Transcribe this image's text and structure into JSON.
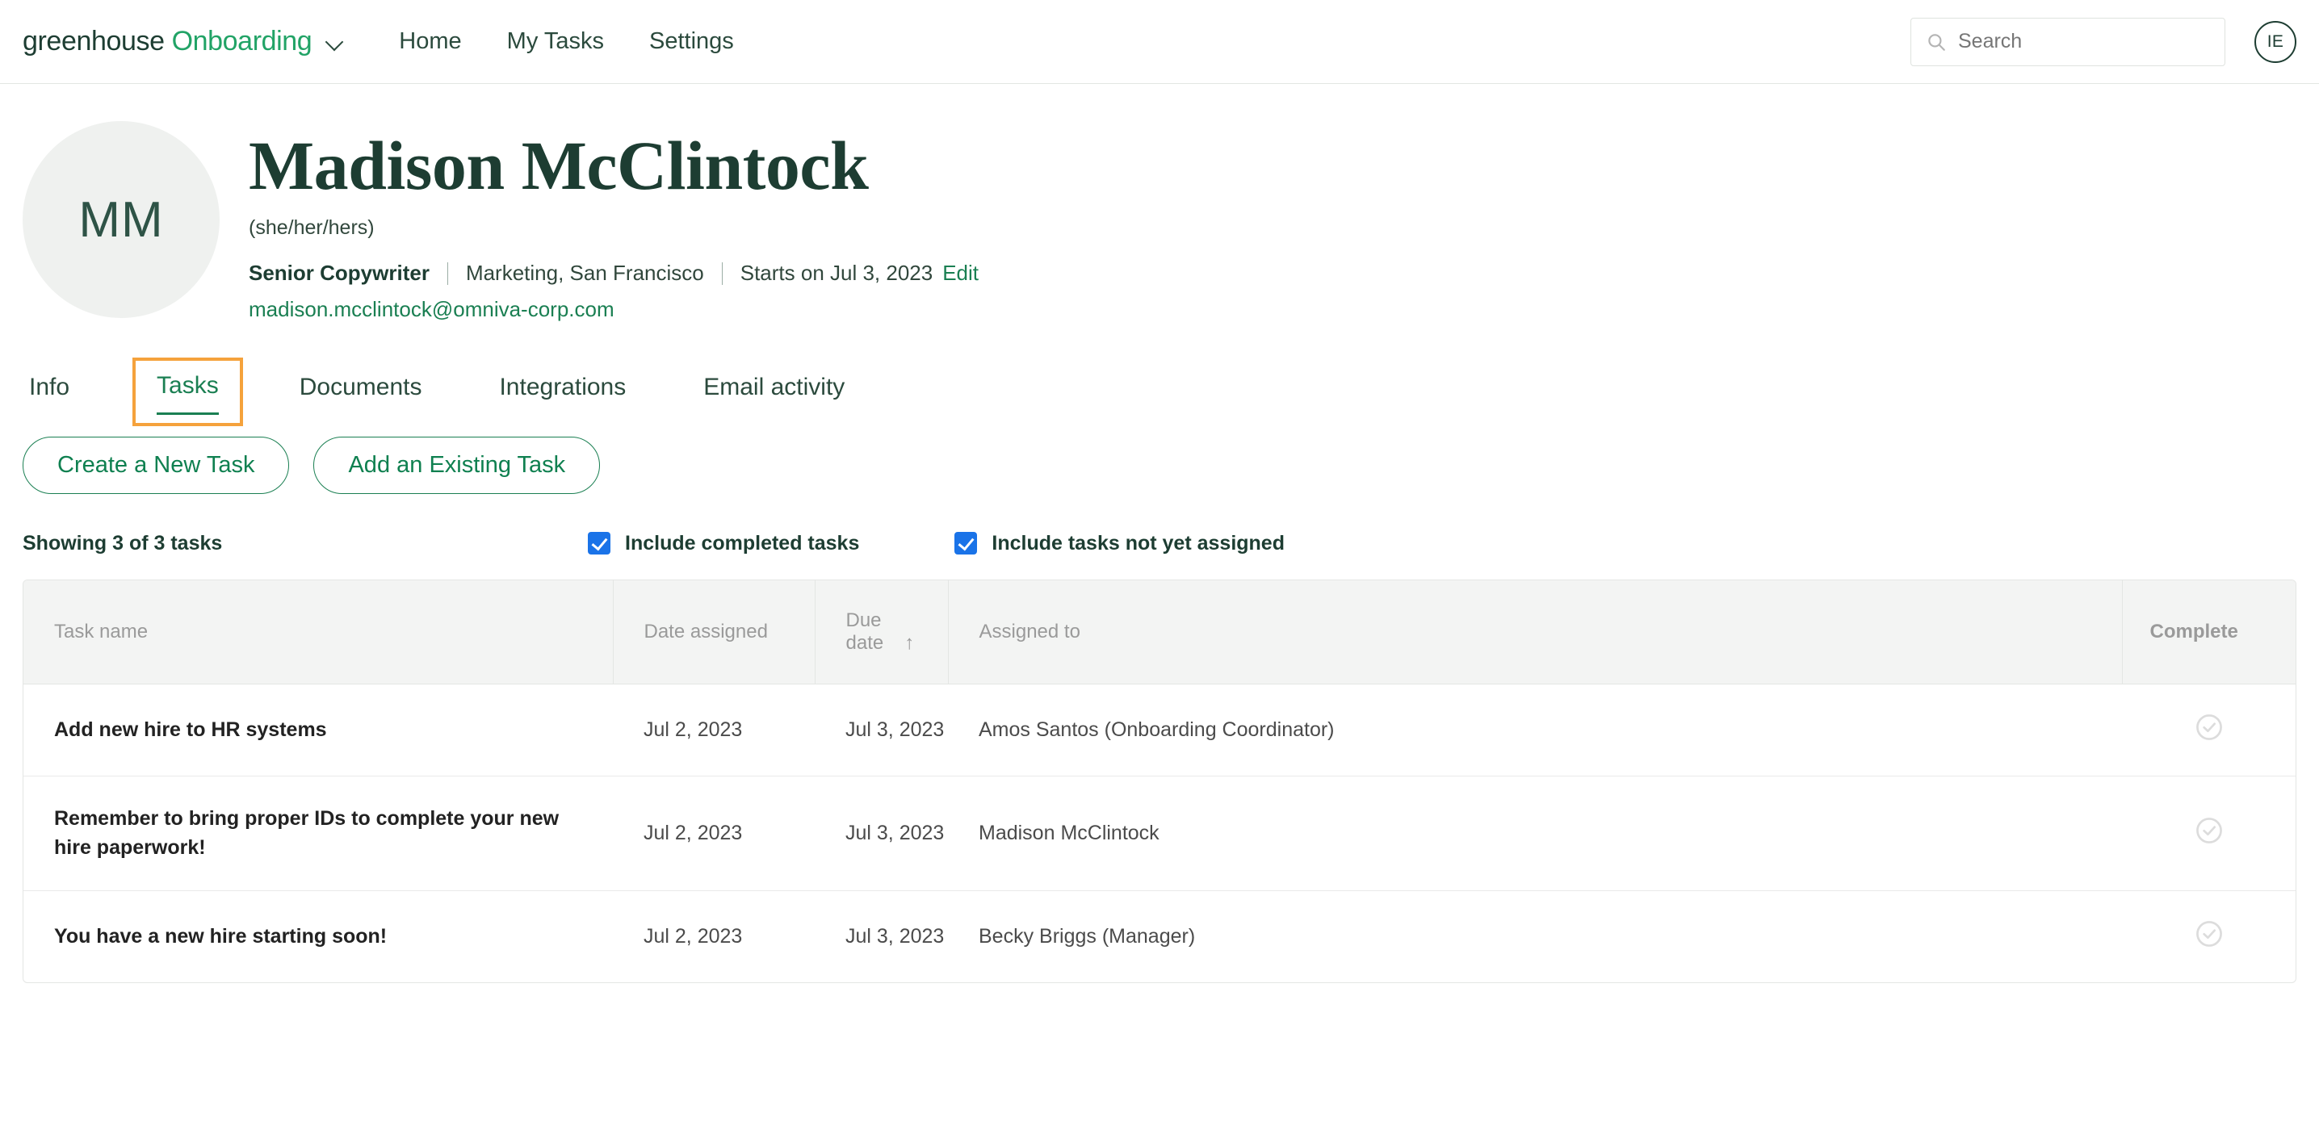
{
  "topnav": {
    "brand_primary": "greenhouse",
    "brand_secondary": "Onboarding",
    "links": [
      {
        "label": "Home"
      },
      {
        "label": "My Tasks"
      },
      {
        "label": "Settings"
      }
    ],
    "search": {
      "placeholder": "Search",
      "value": ""
    },
    "user_initials": "IE"
  },
  "profile": {
    "avatar_initials": "MM",
    "name": "Madison McClintock",
    "pronouns": "(she/her/hers)",
    "title": "Senior Copywriter",
    "department_location": "Marketing, San Francisco",
    "start_date": "Starts on Jul 3, 2023",
    "edit_label": "Edit",
    "email": "madison.mcclintock@omniva-corp.com"
  },
  "tabs": [
    {
      "label": "Info",
      "active": false
    },
    {
      "label": "Tasks",
      "active": true
    },
    {
      "label": "Documents",
      "active": false
    },
    {
      "label": "Integrations",
      "active": false
    },
    {
      "label": "Email activity",
      "active": false
    }
  ],
  "actions": {
    "create_task": "Create a New Task",
    "add_existing_task": "Add an Existing Task"
  },
  "filters": {
    "showing": "Showing 3 of 3 tasks",
    "include_completed": {
      "label": "Include completed tasks",
      "checked": true
    },
    "include_unassigned": {
      "label": "Include tasks not yet assigned",
      "checked": true
    }
  },
  "table": {
    "columns": {
      "task_name": "Task name",
      "date_assigned": "Date assigned",
      "due_date": "Due date",
      "sort_indicator": "↑",
      "assigned_to": "Assigned to",
      "complete": "Complete"
    },
    "rows": [
      {
        "task_name": "Add new hire to HR systems",
        "date_assigned": "Jul 2, 2023",
        "due_date": "Jul 3, 2023",
        "assigned_to": "Amos Santos (Onboarding Coordinator)",
        "complete": false
      },
      {
        "task_name": "Remember to bring proper IDs to complete your new hire paperwork!",
        "date_assigned": "Jul 2, 2023",
        "due_date": "Jul 3, 2023",
        "assigned_to": "Madison McClintock",
        "complete": false
      },
      {
        "task_name": "You have a new hire starting soon!",
        "date_assigned": "Jul 2, 2023",
        "due_date": "Jul 3, 2023",
        "assigned_to": "Becky Briggs (Manager)",
        "complete": false
      }
    ]
  },
  "colors": {
    "brand_dark_green": "#1d3d32",
    "brand_green": "#21a366",
    "link_green": "#1a7f52",
    "focus_orange": "#f5a23c",
    "checkbox_blue": "#1a73e8",
    "header_gray": "#f3f4f3",
    "border_gray": "#e4e6e4",
    "muted_text": "#9a9a9a"
  },
  "icons": {
    "search": "search-icon",
    "chevron_down": "chevron-down-icon",
    "check_circle": "check-circle-icon",
    "sort_asc": "sort-ascending-icon"
  }
}
